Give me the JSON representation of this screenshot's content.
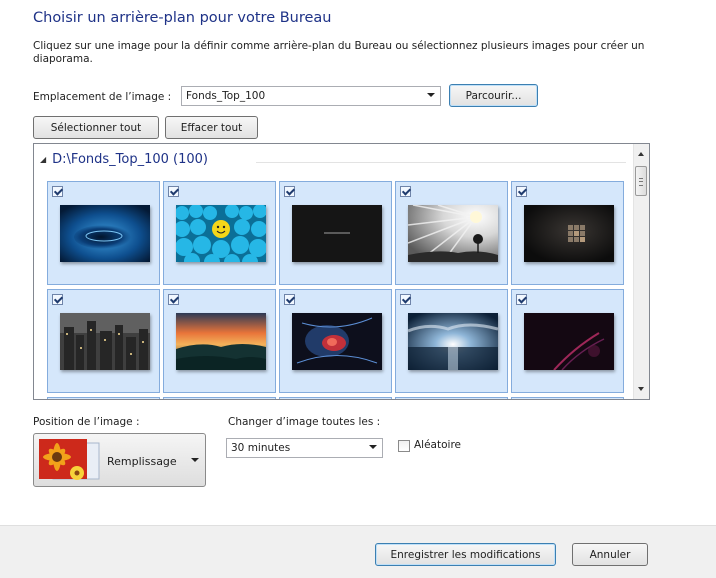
{
  "header": {
    "title": "Choisir un arrière-plan pour votre Bureau",
    "description": "Cliquez sur une image pour la définir comme arrière-plan du Bureau ou sélectionnez plusieurs images pour créer un diaporama."
  },
  "location": {
    "label": "Emplacement de l’image :",
    "value": "Fonds_Top_100",
    "browse_label": "Parcourir..."
  },
  "selection": {
    "select_all_label": "Sélectionner tout",
    "clear_all_label": "Effacer tout"
  },
  "gallery": {
    "group_label": "D:\\Fonds_Top_100 (100)",
    "items": [
      {
        "name": "water-drop-wallpaper",
        "checked": true
      },
      {
        "name": "blue-balls-smiley-wallpaper",
        "checked": true
      },
      {
        "name": "dark-text-wallpaper",
        "checked": true
      },
      {
        "name": "sunburst-tree-wallpaper",
        "checked": true
      },
      {
        "name": "cube-dark-wallpaper",
        "checked": true
      },
      {
        "name": "city-night-wallpaper",
        "checked": true
      },
      {
        "name": "sunset-hills-wallpaper",
        "checked": true
      },
      {
        "name": "abstract-red-blue-wallpaper",
        "checked": true
      },
      {
        "name": "sky-clouds-water-wallpaper",
        "checked": true
      },
      {
        "name": "purple-light-wallpaper",
        "checked": true
      }
    ]
  },
  "position": {
    "label": "Position de l’image :",
    "value": "Remplissage",
    "icon": "flower-wallpaper-icon"
  },
  "interval": {
    "label": "Changer d’image toutes les :",
    "value": "30 minutes",
    "random_label": "Aléatoire",
    "random_checked": false
  },
  "footer": {
    "save_label": "Enregistrer les modifications",
    "cancel_label": "Annuler"
  },
  "colors": {
    "title": "#1e3287",
    "tile_background": "#d5e7fb",
    "tile_border": "#84acdd",
    "footer_background": "#f0f0f0"
  }
}
